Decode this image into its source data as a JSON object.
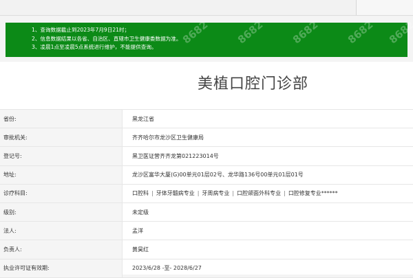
{
  "notice": {
    "lines": [
      "1、查询数据截止到2023年7月9日21时；",
      "2、信息数据结果以各省、自治区、直辖市卫生健康委数据为准。",
      "3、凌晨1点至凌晨5点系统进行维护，不能提供查询。"
    ],
    "background_color": "#0c8a17",
    "watermark": "8682"
  },
  "page": {
    "title": "美植口腔门诊部"
  },
  "rows": [
    {
      "label": "省份:",
      "value": "黑龙江省"
    },
    {
      "label": "审批机关:",
      "value": "齐齐哈尔市龙沙区卫生健康局"
    },
    {
      "label": "登记号:",
      "value": "黑卫医证营齐齐龙第021223014号"
    },
    {
      "label": "地址:",
      "value": "龙沙区富华大厦(G)00单元01层02号、龙华路136号00单元01层01号"
    },
    {
      "label": "诊疗科目:",
      "value": "",
      "subjects": [
        "口腔科",
        "牙体牙髓病专业",
        "牙周病专业",
        "口腔颌面外科专业",
        "口腔修复专业******"
      ]
    },
    {
      "label": "级别:",
      "value": "未定级"
    },
    {
      "label": "法人:",
      "value": "孟洋"
    },
    {
      "label": "负责人:",
      "value": "黄昊红"
    },
    {
      "label": "执业许可证有效期:",
      "value": "2023/6/28 -至- 2028/6/27"
    }
  ]
}
